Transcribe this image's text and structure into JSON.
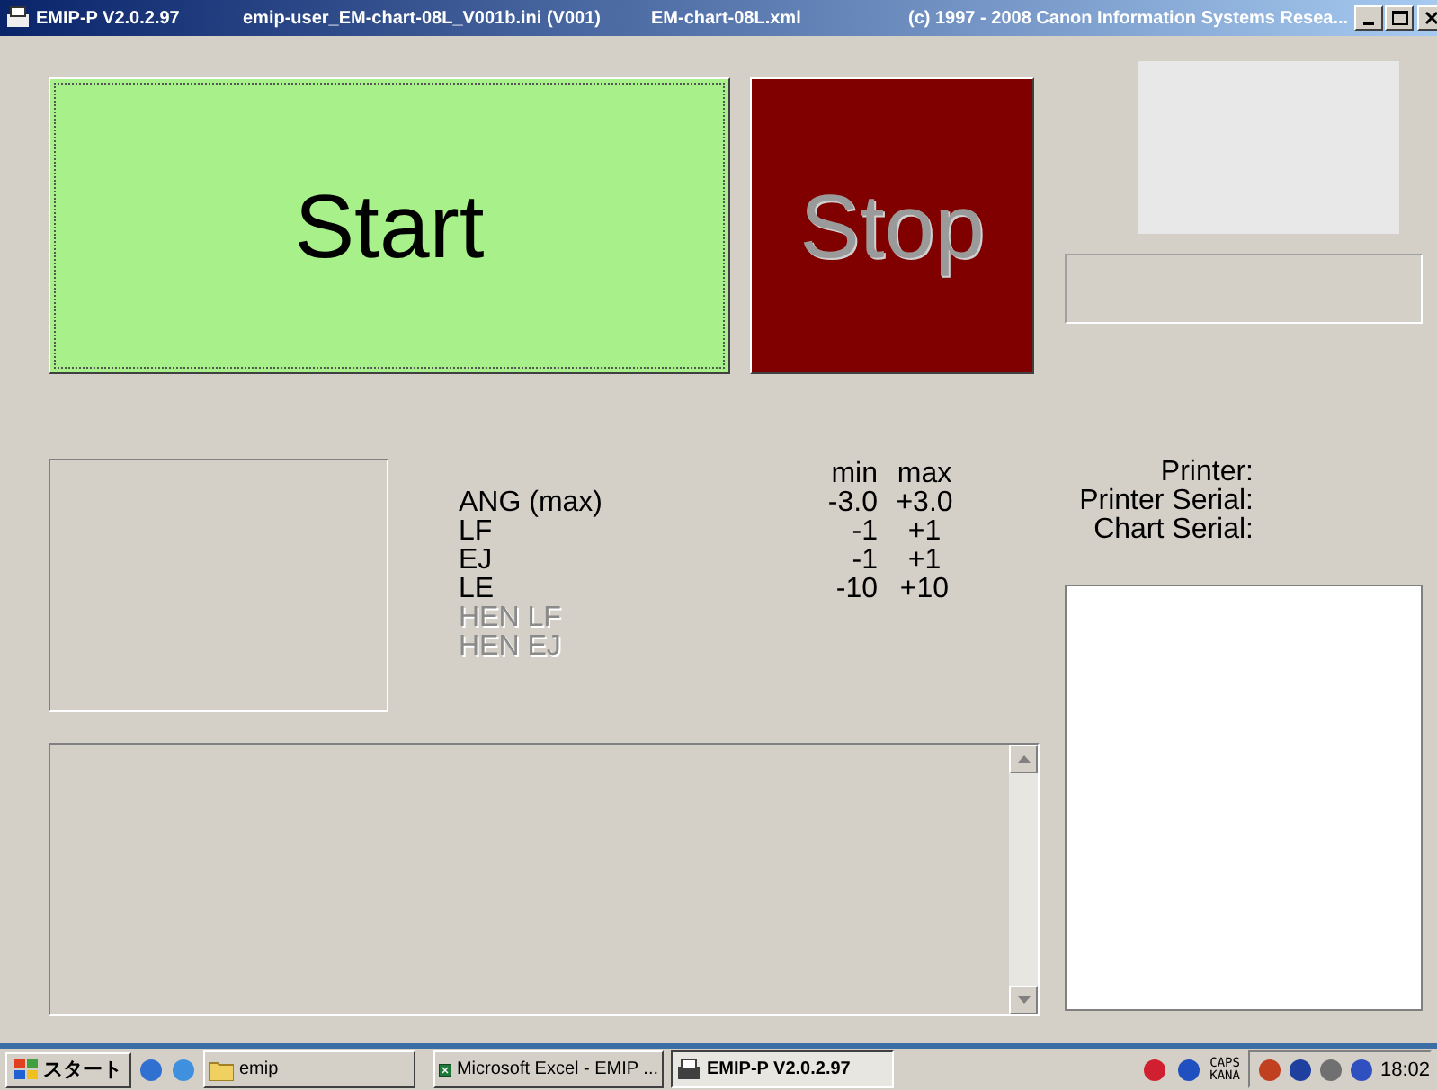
{
  "window": {
    "title": "EMIP-P V2.0.2.97",
    "ini_file": "emip-user_EM-chart-08L_V001b.ini (V001)",
    "chart_file": "EM-chart-08L.xml",
    "copyright": "(c) 1997 - 2008 Canon Information Systems Resea..."
  },
  "start_button": {
    "label": "Start"
  },
  "stop_button": {
    "label": "Stop"
  },
  "limits": {
    "columns": [
      "min",
      "max"
    ],
    "rows": [
      {
        "label": "ANG (max)",
        "min": "-3.0",
        "max": "+3.0",
        "disabled": false
      },
      {
        "label": "LF",
        "min": "-1",
        "max": "+1",
        "disabled": false
      },
      {
        "label": "EJ",
        "min": "-1",
        "max": "+1",
        "disabled": false
      },
      {
        "label": "LE",
        "min": "-10",
        "max": "+10",
        "disabled": false
      },
      {
        "label": "HEN LF",
        "disabled": true
      },
      {
        "label": "HEN EJ",
        "disabled": true
      }
    ]
  },
  "info_labels": [
    "Printer:",
    "Printer Serial:",
    "Chart Serial:"
  ],
  "taskbar": {
    "start": "スタート",
    "buttons": [
      {
        "label": "emip",
        "kind": "folder",
        "selected": false
      },
      {
        "label": "Microsoft Excel - EMIP ...",
        "kind": "excel",
        "selected": false
      },
      {
        "label": "EMIP-P V2.0.2.97",
        "kind": "app",
        "selected": true
      }
    ],
    "caps": "CAPS",
    "kana": "KANA",
    "clock": "18:02"
  }
}
